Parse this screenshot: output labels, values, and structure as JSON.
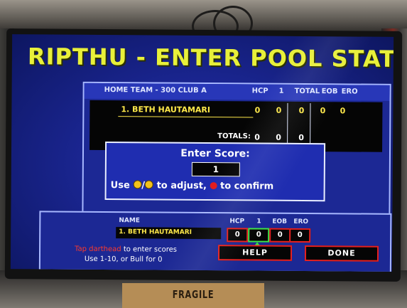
{
  "environment": {
    "box_label": "FRAGILE"
  },
  "app": {
    "title": "RIPTHU - ENTER POOL STATS"
  },
  "stats_table": {
    "team_header": "HOME TEAM - 300 CLUB A",
    "col_hcp": "HCP",
    "col_1": "1",
    "col_total": "TOTAL",
    "col_eob": "EOB",
    "col_ero": "ERO",
    "player": {
      "name": "1.  BETH HAUTAMARI",
      "hcp": "0",
      "game1": "0",
      "total": "0",
      "eob": "0",
      "ero": "0"
    },
    "totals_label": "TOTALS:",
    "totals": {
      "hcp": "0",
      "game1": "0",
      "total": "0"
    }
  },
  "score_dialog": {
    "title": "Enter Score:",
    "value": "1",
    "hint_prefix": "Use",
    "hint_mid": "to adjust,",
    "hint_suffix": "to confirm",
    "adjust_icons": "up-down-coin-icons",
    "confirm_icon": "red-button-icon"
  },
  "entry_panel": {
    "col_name": "NAME",
    "col_hcp": "HCP",
    "col_1": "1",
    "col_eob": "EOB",
    "col_ero": "ERO",
    "player_name": "1.  BETH HAUTAMARI",
    "hcp": "0",
    "game1": "0",
    "eob": "0",
    "ero": "0",
    "tap_hint_red": "Tap darthead",
    "tap_hint_rest": "to enter scores",
    "use_hint": "Use 1-10, or Bull for 0",
    "help_label": "HELP",
    "done_label": "DONE"
  },
  "colors": {
    "screen_blue": "#1a2590",
    "title_yellow": "#e8f03a",
    "value_yellow": "#ffe94a",
    "alert_red": "#e52020",
    "active_green": "#3ee34a"
  }
}
